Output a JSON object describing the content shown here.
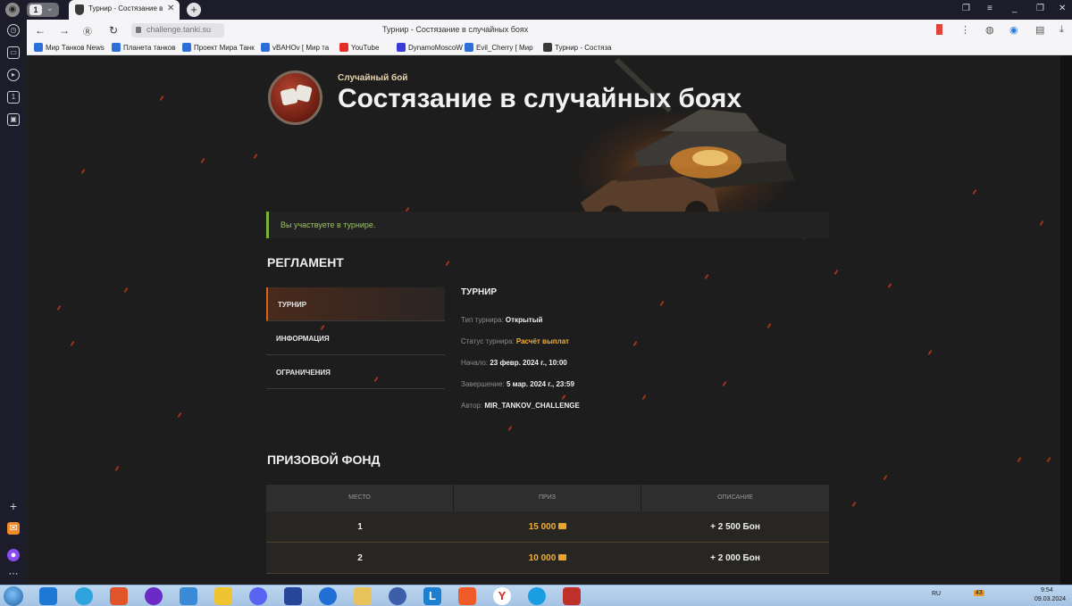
{
  "browser": {
    "tab_count": "1",
    "tab_title": "Турнир - Состязание в",
    "address_url": "challenge.tanki.su",
    "window_title": "Турнир - Состязание в случайных боях",
    "bookmarks": [
      {
        "label": "Мир Танков News",
        "icon": "vk-icon",
        "color": "#2d6fd8"
      },
      {
        "label": "Планета танков",
        "icon": "vk-icon",
        "color": "#2d6fd8"
      },
      {
        "label": "Проект Мира Танк",
        "icon": "vk-icon",
        "color": "#2d6fd8"
      },
      {
        "label": "vBAHOv [ Мир та",
        "icon": "vk-icon",
        "color": "#2d6fd8"
      },
      {
        "label": "YouTube",
        "icon": "youtube-icon",
        "color": "#e52d27"
      },
      {
        "label": "DynamoMoscoW",
        "icon": "twitch-icon",
        "color": "#3a3ad8"
      },
      {
        "label": "Evil_Cherry [ Мир",
        "icon": "vk-icon",
        "color": "#2d6fd8"
      },
      {
        "label": "Турнир - Состяза",
        "icon": "tanks-icon",
        "color": "#3a3a3a"
      }
    ]
  },
  "hero": {
    "mode_label": "Случайный бой",
    "title": "Состязание в случайных боях"
  },
  "notice": {
    "text": "Вы участвуете в турнире."
  },
  "regulations": {
    "heading": "РЕГЛАМЕНТ",
    "tabs": [
      {
        "label": "ТУРНИР",
        "active": true
      },
      {
        "label": "ИНФОРМАЦИЯ",
        "active": false
      },
      {
        "label": "ОГРАНИЧЕНИЯ",
        "active": false
      }
    ],
    "panel": {
      "heading": "ТУРНИР",
      "rows": [
        {
          "key": "Тип турнира:",
          "value": "Открытый",
          "accent": false
        },
        {
          "key": "Статус турнира:",
          "value": "Расчёт выплат",
          "accent": true
        },
        {
          "key": "Начало:",
          "value": "23 февр. 2024 г., 10:00",
          "accent": false
        },
        {
          "key": "Завершение:",
          "value": "5 мар. 2024 г., 23:59",
          "accent": false
        },
        {
          "key": "Автор:",
          "value": "MIR_TANKOV_CHALLENGE",
          "accent": false
        }
      ]
    }
  },
  "prize_fund": {
    "heading": "ПРИЗОВОЙ ФОНД",
    "columns": [
      "МЕСТО",
      "ПРИЗ",
      "ОПИСАНИЕ"
    ],
    "rows": [
      {
        "place": "1",
        "prize": "15 000",
        "description": "+ 2 500 Бон"
      },
      {
        "place": "2",
        "prize": "10 000",
        "description": "+ 2 000 Бон"
      }
    ]
  },
  "taskbar": {
    "lang": "RU",
    "badge": "43",
    "time": "9:54",
    "date": "09.03.2024"
  }
}
